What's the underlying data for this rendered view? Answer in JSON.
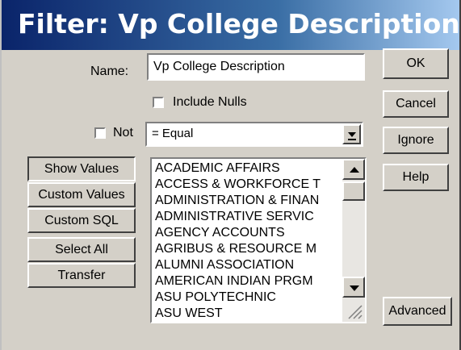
{
  "window": {
    "title": "Filter: Vp College Description"
  },
  "form": {
    "name_label": "Name:",
    "name_value": "Vp College Description",
    "include_nulls_label": "Include Nulls",
    "include_nulls_checked": false,
    "not_label": "Not",
    "not_checked": false,
    "operator_value": "= Equal"
  },
  "buttons": {
    "ok": "OK",
    "cancel": "Cancel",
    "ignore": "Ignore",
    "help": "Help",
    "advanced": "Advanced"
  },
  "left_buttons": {
    "show_values": "Show Values",
    "custom_values": "Custom Values",
    "custom_sql": "Custom SQL",
    "select_all": "Select All",
    "transfer": "Transfer"
  },
  "values_list": {
    "items": [
      "ACADEMIC AFFAIRS",
      "ACCESS & WORKFORCE T",
      "ADMINISTRATION & FINAN",
      "ADMINISTRATIVE SERVIC",
      "AGENCY ACCOUNTS",
      "AGRIBUS & RESOURCE M",
      "ALUMNI ASSOCIATION",
      "AMERICAN INDIAN PRGM",
      "ASU POLYTECHNIC",
      "ASU WEST"
    ]
  }
}
